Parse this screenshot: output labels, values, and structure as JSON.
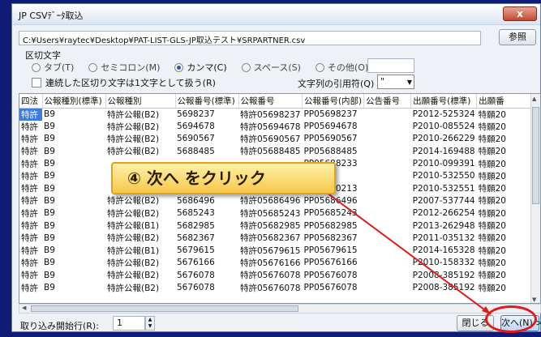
{
  "window": {
    "title": "JP CSVﾃﾞｰﾀ取込",
    "close_label": "x"
  },
  "file": {
    "path": "C:¥Users¥raytec¥Desktop¥PAT-LIST-GLS-JP取込テスト¥SRPARTNER.csv",
    "browse_label": "参照"
  },
  "separator": {
    "label": "区切文字",
    "options": [
      {
        "label": "タブ(T)",
        "selected": false
      },
      {
        "label": "セミコロン(M)",
        "selected": false
      },
      {
        "label": "カンマ(C)",
        "selected": true
      },
      {
        "label": "スペース(S)",
        "selected": false
      },
      {
        "label": "その他(O):",
        "selected": false
      }
    ],
    "consecutive_label": "連続した区切り文字は1文字として扱う(R)",
    "quote_label": "文字列の引用符(Q)",
    "quote_value": "\""
  },
  "table": {
    "columns": [
      "四法",
      "公報種別(標準)",
      "公報種別",
      "公報番号(標準)",
      "公報番号",
      "公報番号(内部)",
      "公告番号",
      "出願番号(標準)",
      "出願番"
    ],
    "rows": [
      [
        "特許",
        "B9",
        "特許公報(B2)",
        "5698237",
        "特許05698237",
        "PP05698237",
        "",
        "P2012-525324",
        "特願20"
      ],
      [
        "特許",
        "B9",
        "特許公報(B2)",
        "5694678",
        "特許05694678",
        "PP05694678",
        "",
        "P2010-085524",
        "特願20"
      ],
      [
        "特許",
        "B9",
        "特許公報(B2)",
        "5690567",
        "特許05690567",
        "PP05690567",
        "",
        "P2010-266229",
        "特願20"
      ],
      [
        "特許",
        "B9",
        "特許公報(B2)",
        "5688485",
        "特許05688485",
        "PP05688485",
        "",
        "P2014-169488",
        "特願20"
      ],
      [
        "特許",
        "B9",
        "",
        "",
        "",
        "PP05688233",
        "",
        "P2010-099391",
        "特願20"
      ],
      [
        "特許",
        "B9",
        "",
        "",
        "",
        "687061",
        "",
        "P2010-532550",
        "特願20"
      ],
      [
        "特許",
        "B9",
        "",
        "",
        "",
        "PP05530213",
        "",
        "P2010-532551",
        "特願20"
      ],
      [
        "特許",
        "B9",
        "特許公報(B2)",
        "5686496",
        "特許05686496",
        "PP05686496",
        "",
        "P2007-537744",
        "特願20"
      ],
      [
        "特許",
        "B9",
        "特許公報(B2)",
        "5685243",
        "特許05685243",
        "PP05685243",
        "",
        "P2012-266254",
        "特願20"
      ],
      [
        "特許",
        "B9",
        "特許公報(B1)",
        "5682985",
        "特許05682985",
        "PP05682985",
        "",
        "P2013-262948",
        "特願20"
      ],
      [
        "特許",
        "B9",
        "特許公報(B2)",
        "5682367",
        "特許05682367",
        "PP05682367",
        "",
        "P2011-035132",
        "特願20"
      ],
      [
        "特許",
        "B9",
        "特許公報(B1)",
        "5679615",
        "特許05679615",
        "PP05679615",
        "",
        "P2014-165328",
        "特願20"
      ],
      [
        "特許",
        "B9",
        "特許公報(B2)",
        "5676166",
        "特許05676166",
        "PP05676166",
        "",
        "P2010-158332",
        "特願20"
      ],
      [
        "特許",
        "B9",
        "特許公報(B2)",
        "5676078",
        "特許05676078",
        "PP05676078",
        "",
        "P2008-385192",
        "特願20"
      ],
      [
        "特許",
        "B9",
        "特許公報(B2)",
        "5676078",
        "特許05676078",
        "PP05676078",
        "",
        "P2008-385192",
        "特願20"
      ]
    ]
  },
  "footer": {
    "start_row_label": "取り込み開始行(R):",
    "start_row_value": "1",
    "close_label": "閉じる",
    "next_label": "次へ(N) >"
  },
  "annotation": {
    "text": "④ 次へ をクリック"
  },
  "colors": {
    "background": "#0e1c78",
    "callout": "#f6c84b",
    "highlight": "#e11b1b",
    "selection": "#3d7be0"
  }
}
